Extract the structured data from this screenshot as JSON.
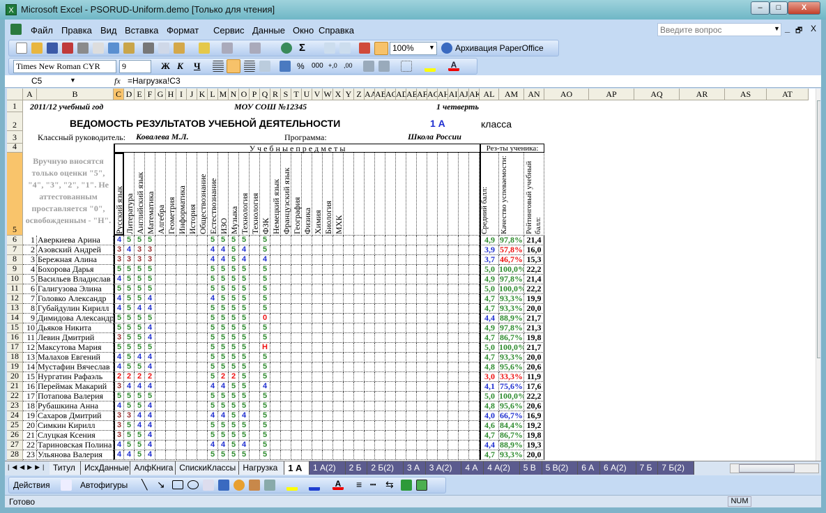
{
  "window": {
    "title": "Microsoft Excel - PSORUD-Uniform.demo  [Только для чтения]",
    "minimize": "–",
    "maximize": "□",
    "close": "X"
  },
  "menu": {
    "items": [
      "Файл",
      "Правка",
      "Вид",
      "Вставка",
      "Формат",
      "Сервис",
      "Данные",
      "Окно",
      "Справка"
    ],
    "help_placeholder": "Введите вопрос",
    "doc_min": "_",
    "doc_restore": "🗗",
    "doc_close": "X"
  },
  "toolbar": {
    "zoom": "100%",
    "paperoffice": "Архивация PaperOffice",
    "font": "Times New Roman CYR",
    "size": "9",
    "bold": "Ж",
    "italic": "К",
    "underline": "Ч",
    "percent": "%",
    "thousands": "000",
    "inc_dec": "+,0",
    "dec_dec": ",00",
    "sigma": "Σ"
  },
  "formula": {
    "name_box": "C5",
    "fx": "fx",
    "value": "=Нагрузка!C3"
  },
  "columns": [
    "A",
    "B",
    "C",
    "D",
    "E",
    "F",
    "G",
    "H",
    "I",
    "J",
    "K",
    "L",
    "M",
    "N",
    "O",
    "P",
    "Q",
    "R",
    "S",
    "T",
    "U",
    "V",
    "W",
    "X",
    "Y",
    "Z",
    "AA",
    "AB",
    "AC",
    "AD",
    "AE",
    "AF",
    "AG",
    "AH",
    "AI",
    "AJ",
    "AK",
    "AL",
    "AM",
    "AN",
    "AO",
    "AP",
    "AQ",
    "AR",
    "AS",
    "AT"
  ],
  "selected_cell": "C5",
  "header": {
    "year": "2011/12 учебный год",
    "school": "МОУ СОШ  №12345",
    "quarter": "1 четверть",
    "title": "ВЕДОМОСТЬ РЕЗУЛЬТАТОВ УЧЕБНОЙ ДЕЯТЕЛЬНОСТИ",
    "class": "1 А",
    "class_word": "класса",
    "teacher_label": "Классный руководитель:",
    "teacher": "Ковалева М.Л.",
    "program_label": "Программа:",
    "program": "Школа России",
    "subjects_title": "У ч е б н ы е     п р е д м е т ы",
    "results_title": "Рез-ты ученика:",
    "note": "Вручную вносятся только оценки \"5\", \"4\", \"3\", \"2\", \"1\". Не аттестованным проставляется \"0\", освобожденным - \"Н\"."
  },
  "subjects": [
    "Русский язык",
    "Литература",
    "Английский язык",
    "Математика",
    "Алгебра",
    "Геометрия",
    "Информатика",
    "История",
    "Обществознание",
    "Естествознание",
    "ИЗО",
    "Музыка",
    "Технология",
    "Технология",
    "ФЗК",
    "Немецкий язык",
    "Французский язык",
    "География",
    "Физика",
    "Химия",
    "Биология",
    "МХК"
  ],
  "result_columns": [
    "Средний балл:",
    "Качество успеваемости:",
    "Рейтинговый учебный балл:"
  ],
  "grade_colors": {
    "5": "#2e8b2e",
    "4": "#1f2fd0",
    "3": "#9b2d2d",
    "2": "#ee1111",
    "0": "#ee1111",
    "Н": "#ee1111"
  },
  "students": [
    {
      "n": "1",
      "name": "Аверкиева Арина",
      "g": [
        "4",
        "5",
        "5",
        "5",
        "",
        "",
        "",
        "",
        "",
        "5",
        "5",
        "5",
        "5",
        "",
        "5"
      ],
      "avg": "4,9",
      "q": "97,8%",
      "r": "21,4"
    },
    {
      "n": "2",
      "name": "Азовский Андрей",
      "g": [
        "3",
        "4",
        "3",
        "3",
        "",
        "",
        "",
        "",
        "",
        "4",
        "4",
        "5",
        "4",
        "",
        "5"
      ],
      "avg": "3,9",
      "q": "57,8%",
      "r": "16,0"
    },
    {
      "n": "3",
      "name": "Бережная Алина",
      "g": [
        "3",
        "3",
        "3",
        "3",
        "",
        "",
        "",
        "",
        "",
        "4",
        "4",
        "5",
        "4",
        "",
        "4"
      ],
      "avg": "3,7",
      "q": "46,7%",
      "r": "15,3"
    },
    {
      "n": "4",
      "name": "Бохорова Дарья",
      "g": [
        "5",
        "5",
        "5",
        "5",
        "",
        "",
        "",
        "",
        "",
        "5",
        "5",
        "5",
        "5",
        "",
        "5"
      ],
      "avg": "5,0",
      "q": "100,0%",
      "r": "22,2"
    },
    {
      "n": "5",
      "name": "Васильев Владислав",
      "g": [
        "4",
        "5",
        "5",
        "5",
        "",
        "",
        "",
        "",
        "",
        "5",
        "5",
        "5",
        "5",
        "",
        "5"
      ],
      "avg": "4,9",
      "q": "97,8%",
      "r": "21,4"
    },
    {
      "n": "6",
      "name": "Галигузова Элина",
      "g": [
        "5",
        "5",
        "5",
        "5",
        "",
        "",
        "",
        "",
        "",
        "5",
        "5",
        "5",
        "5",
        "",
        "5"
      ],
      "avg": "5,0",
      "q": "100,0%",
      "r": "22,2"
    },
    {
      "n": "7",
      "name": "Головко Александр",
      "g": [
        "4",
        "5",
        "5",
        "4",
        "",
        "",
        "",
        "",
        "",
        "4",
        "5",
        "5",
        "5",
        "",
        "5"
      ],
      "avg": "4,7",
      "q": "93,3%",
      "r": "19,9"
    },
    {
      "n": "8",
      "name": "Губайдулин Кирилл",
      "g": [
        "4",
        "5",
        "4",
        "4",
        "",
        "",
        "",
        "",
        "",
        "5",
        "5",
        "5",
        "5",
        "",
        "5"
      ],
      "avg": "4,7",
      "q": "93,3%",
      "r": "20,0"
    },
    {
      "n": "9",
      "name": "Димидова Александра",
      "g": [
        "5",
        "5",
        "5",
        "5",
        "",
        "",
        "",
        "",
        "",
        "5",
        "5",
        "5",
        "5",
        "",
        "0"
      ],
      "avg": "4,4",
      "q": "88,9%",
      "r": "21,7"
    },
    {
      "n": "10",
      "name": "Дьяков Никита",
      "g": [
        "5",
        "5",
        "5",
        "4",
        "",
        "",
        "",
        "",
        "",
        "5",
        "5",
        "5",
        "5",
        "",
        "5"
      ],
      "avg": "4,9",
      "q": "97,8%",
      "r": "21,3"
    },
    {
      "n": "11",
      "name": "Левин Дмитрий",
      "g": [
        "3",
        "5",
        "5",
        "4",
        "",
        "",
        "",
        "",
        "",
        "5",
        "5",
        "5",
        "5",
        "",
        "5"
      ],
      "avg": "4,7",
      "q": "86,7%",
      "r": "19,8"
    },
    {
      "n": "12",
      "name": "Максутова Мария",
      "g": [
        "5",
        "5",
        "5",
        "5",
        "",
        "",
        "",
        "",
        "",
        "5",
        "5",
        "5",
        "5",
        "",
        "Н"
      ],
      "avg": "5,0",
      "q": "100,0%",
      "r": "21,7"
    },
    {
      "n": "13",
      "name": "Малахов Евгений",
      "g": [
        "4",
        "5",
        "4",
        "4",
        "",
        "",
        "",
        "",
        "",
        "5",
        "5",
        "5",
        "5",
        "",
        "5"
      ],
      "avg": "4,7",
      "q": "93,3%",
      "r": "20,0"
    },
    {
      "n": "14",
      "name": "Мустафин Вячеслав",
      "g": [
        "4",
        "5",
        "5",
        "4",
        "",
        "",
        "",
        "",
        "",
        "5",
        "5",
        "5",
        "5",
        "",
        "5"
      ],
      "avg": "4,8",
      "q": "95,6%",
      "r": "20,6"
    },
    {
      "n": "15",
      "name": "Нургатин Рафаэль",
      "g": [
        "2",
        "2",
        "2",
        "2",
        "",
        "",
        "",
        "",
        "",
        "5",
        "2",
        "2",
        "5",
        "",
        "5"
      ],
      "avg": "3,0",
      "q": "33,3%",
      "r": "11,9"
    },
    {
      "n": "16",
      "name": "Переймак Макарий",
      "g": [
        "3",
        "4",
        "4",
        "4",
        "",
        "",
        "",
        "",
        "",
        "4",
        "4",
        "5",
        "5",
        "",
        "4"
      ],
      "avg": "4,1",
      "q": "75,6%",
      "r": "17,6"
    },
    {
      "n": "17",
      "name": "Потапова Валерия",
      "g": [
        "5",
        "5",
        "5",
        "5",
        "",
        "",
        "",
        "",
        "",
        "5",
        "5",
        "5",
        "5",
        "",
        "5"
      ],
      "avg": "5,0",
      "q": "100,0%",
      "r": "22,2"
    },
    {
      "n": "18",
      "name": "Рубашкина Анна",
      "g": [
        "4",
        "5",
        "5",
        "4",
        "",
        "",
        "",
        "",
        "",
        "5",
        "5",
        "5",
        "5",
        "",
        "5"
      ],
      "avg": "4,8",
      "q": "95,6%",
      "r": "20,6"
    },
    {
      "n": "19",
      "name": "Сахаров Дмитрий",
      "g": [
        "3",
        "3",
        "4",
        "4",
        "",
        "",
        "",
        "",
        "",
        "4",
        "4",
        "5",
        "4",
        "",
        "5"
      ],
      "avg": "4,0",
      "q": "66,7%",
      "r": "16,9"
    },
    {
      "n": "20",
      "name": "Симкин Кирилл",
      "g": [
        "3",
        "5",
        "4",
        "4",
        "",
        "",
        "",
        "",
        "",
        "5",
        "5",
        "5",
        "5",
        "",
        "5"
      ],
      "avg": "4,6",
      "q": "84,4%",
      "r": "19,2"
    },
    {
      "n": "21",
      "name": "Слуцкая Ксения",
      "g": [
        "3",
        "5",
        "5",
        "4",
        "",
        "",
        "",
        "",
        "",
        "5",
        "5",
        "5",
        "5",
        "",
        "5"
      ],
      "avg": "4,7",
      "q": "86,7%",
      "r": "19,8"
    },
    {
      "n": "22",
      "name": "Тариновская Полина",
      "g": [
        "4",
        "5",
        "5",
        "4",
        "",
        "",
        "",
        "",
        "",
        "4",
        "4",
        "5",
        "4",
        "",
        "5"
      ],
      "avg": "4,4",
      "q": "88,9%",
      "r": "19,3"
    },
    {
      "n": "23",
      "name": "Ульянова Валерия",
      "g": [
        "4",
        "4",
        "5",
        "4",
        "",
        "",
        "",
        "",
        "",
        "5",
        "5",
        "5",
        "5",
        "",
        "5"
      ],
      "avg": "4,7",
      "q": "93,3%",
      "r": "20,0"
    }
  ],
  "sheet_tabs": [
    "Титул",
    "ИсхДанные",
    "АлфКнига",
    "СпискиКлассы",
    "Нагрузка",
    "1 А",
    "1 А(2)",
    "2 Б",
    "2 Б(2)",
    "3 А",
    "3 А(2)",
    "4 А",
    "4 А(2)",
    "5 В",
    "5 В(2)",
    "6 А",
    "6 А(2)",
    "7 Б",
    "7 Б(2)"
  ],
  "active_tab": "1 А",
  "drawing": {
    "actions": "Действия",
    "autoshapes": "Автофигуры"
  },
  "status": {
    "text": "Готово",
    "num": "NUM"
  }
}
